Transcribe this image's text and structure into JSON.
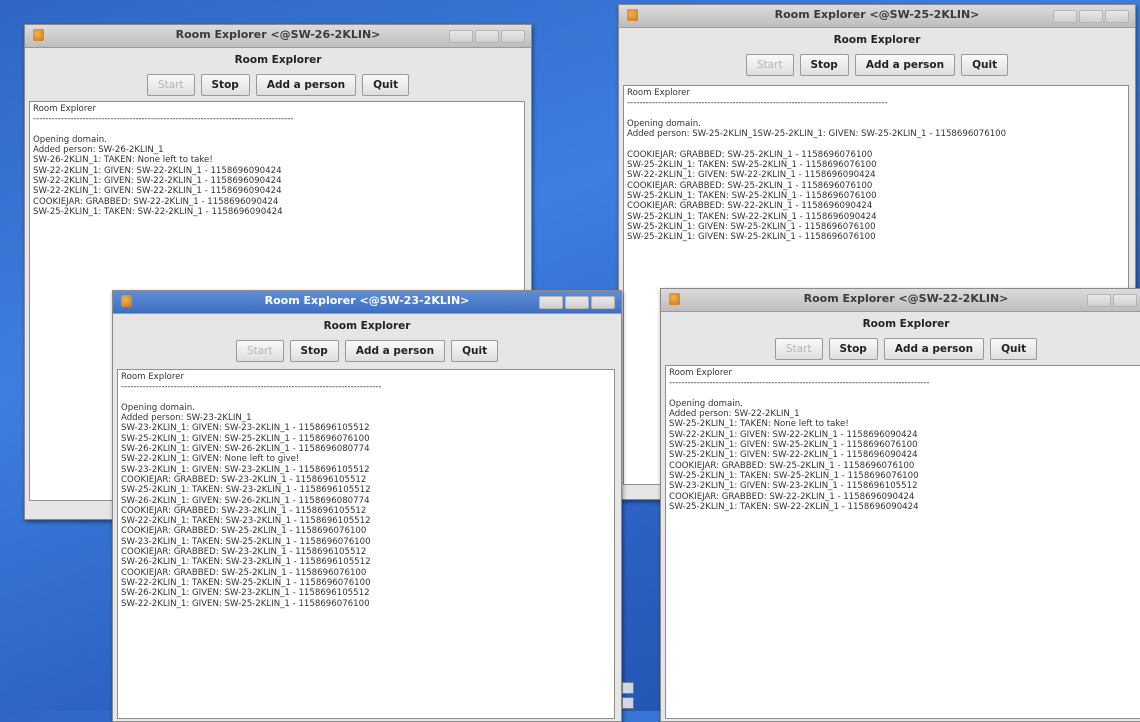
{
  "windows": [
    {
      "title": "Room Explorer <@SW-26-2KLIN>",
      "header": "Room Explorer",
      "buttons": [
        "Start",
        "Stop",
        "Add a person",
        "Quit"
      ],
      "log": [
        "Room Explorer",
        "------------------------------------------------------------------------------------",
        "",
        "Opening domain.",
        "Added person: SW-26-2KLIN_1",
        "SW-26-2KLIN_1: TAKEN: None left to take!",
        "SW-22-2KLIN_1: GIVEN: SW-22-2KLIN_1 - 1158696090424",
        "SW-22-2KLIN_1: GIVEN: SW-22-2KLIN_1 - 1158696090424",
        "SW-22-2KLIN_1: GIVEN: SW-22-2KLIN_1 - 1158696090424",
        "COOKIEJAR: GRABBED: SW-22-2KLIN_1 - 1158696090424",
        "SW-25-2KLIN_1: TAKEN: SW-22-2KLIN_1 - 1158696090424"
      ]
    },
    {
      "title": "Room Explorer <@SW-25-2KLIN>",
      "header": "Room Explorer",
      "buttons": [
        "Start",
        "Stop",
        "Add a person",
        "Quit"
      ],
      "log": [
        "Room Explorer",
        "------------------------------------------------------------------------------------",
        "",
        "Opening domain.",
        "Added person: SW-25-2KLIN_1SW-25-2KLIN_1: GIVEN: SW-25-2KLIN_1 - 1158696076100",
        "",
        "COOKIEJAR: GRABBED: SW-25-2KLIN_1 - 1158696076100",
        "SW-25-2KLIN_1: TAKEN: SW-25-2KLIN_1 - 1158696076100",
        "SW-22-2KLIN_1: GIVEN: SW-22-2KLIN_1 - 1158696090424",
        "COOKIEJAR: GRABBED: SW-25-2KLIN_1 - 1158696076100",
        "SW-25-2KLIN_1: TAKEN: SW-25-2KLIN_1 - 1158696076100",
        "COOKIEJAR: GRABBED: SW-22-2KLIN_1 - 1158696090424",
        "SW-25-2KLIN_1: TAKEN: SW-22-2KLIN_1 - 1158696090424",
        "SW-25-2KLIN_1: GIVEN: SW-25-2KLIN_1 - 1158696076100",
        "SW-25-2KLIN_1: GIVEN: SW-25-2KLIN_1 - 1158696076100"
      ]
    },
    {
      "title": "Room Explorer <@SW-23-2KLIN>",
      "header": "Room Explorer",
      "buttons": [
        "Start",
        "Stop",
        "Add a person",
        "Quit"
      ],
      "log": [
        "Room Explorer",
        "------------------------------------------------------------------------------------",
        "",
        "Opening domain.",
        "Added person: SW-23-2KLIN_1",
        "SW-23-2KLIN_1: GIVEN: SW-23-2KLIN_1 - 1158696105512",
        "SW-25-2KLIN_1: GIVEN: SW-25-2KLIN_1 - 1158696076100",
        "SW-26-2KLIN_1: GIVEN: SW-26-2KLIN_1 - 1158696080774",
        "SW-22-2KLIN_1: GIVEN: None left to give!",
        "SW-23-2KLIN_1: GIVEN: SW-23-2KLIN_1 - 1158696105512",
        "COOKIEJAR: GRABBED: SW-23-2KLIN_1 - 1158696105512",
        "SW-25-2KLIN_1: TAKEN: SW-23-2KLIN_1 - 1158696105512",
        "SW-26-2KLIN_1: GIVEN: SW-26-2KLIN_1 - 1158696080774",
        "COOKIEJAR: GRABBED: SW-23-2KLIN_1 - 1158696105512",
        "SW-22-2KLIN_1: TAKEN: SW-23-2KLIN_1 - 1158696105512",
        "COOKIEJAR: GRABBED: SW-25-2KLIN_1 - 1158696076100",
        "SW-23-2KLIN_1: TAKEN: SW-25-2KLIN_1 - 1158696076100",
        "COOKIEJAR: GRABBED: SW-23-2KLIN_1 - 1158696105512",
        "SW-26-2KLIN_1: TAKEN: SW-23-2KLIN_1 - 1158696105512",
        "COOKIEJAR: GRABBED: SW-25-2KLIN_1 - 1158696076100",
        "SW-22-2KLIN_1: TAKEN: SW-25-2KLIN_1 - 1158696076100",
        "SW-26-2KLIN_1: GIVEN: SW-23-2KLIN_1 - 1158696105512",
        "SW-22-2KLIN_1: GIVEN: SW-25-2KLIN_1 - 1158696076100"
      ]
    },
    {
      "title": "Room Explorer <@SW-22-2KLIN>",
      "header": "Room Explorer",
      "buttons": [
        "Start",
        "Stop",
        "Add a person",
        "Quit"
      ],
      "log": [
        "Room Explorer",
        "------------------------------------------------------------------------------------",
        "",
        "Opening domain.",
        "Added person: SW-22-2KLIN_1",
        "SW-25-2KLIN_1: TAKEN: None left to take!",
        "SW-22-2KLIN_1: GIVEN: SW-22-2KLIN_1 - 1158696090424",
        "SW-25-2KLIN_1: GIVEN: SW-25-2KLIN_1 - 1158696076100",
        "SW-25-2KLIN_1: GIVEN: SW-22-2KLIN_1 - 1158696090424",
        "COOKIEJAR: GRABBED: SW-25-2KLIN_1 - 1158696076100",
        "SW-25-2KLIN_1: TAKEN: SW-25-2KLIN_1 - 1158696076100",
        "SW-23-2KLIN_1: GIVEN: SW-23-2KLIN_1 - 1158696105512",
        "COOKIEJAR: GRABBED: SW-22-2KLIN_1 - 1158696090424",
        "SW-25-2KLIN_1: TAKEN: SW-22-2KLIN_1 - 1158696090424"
      ]
    }
  ]
}
